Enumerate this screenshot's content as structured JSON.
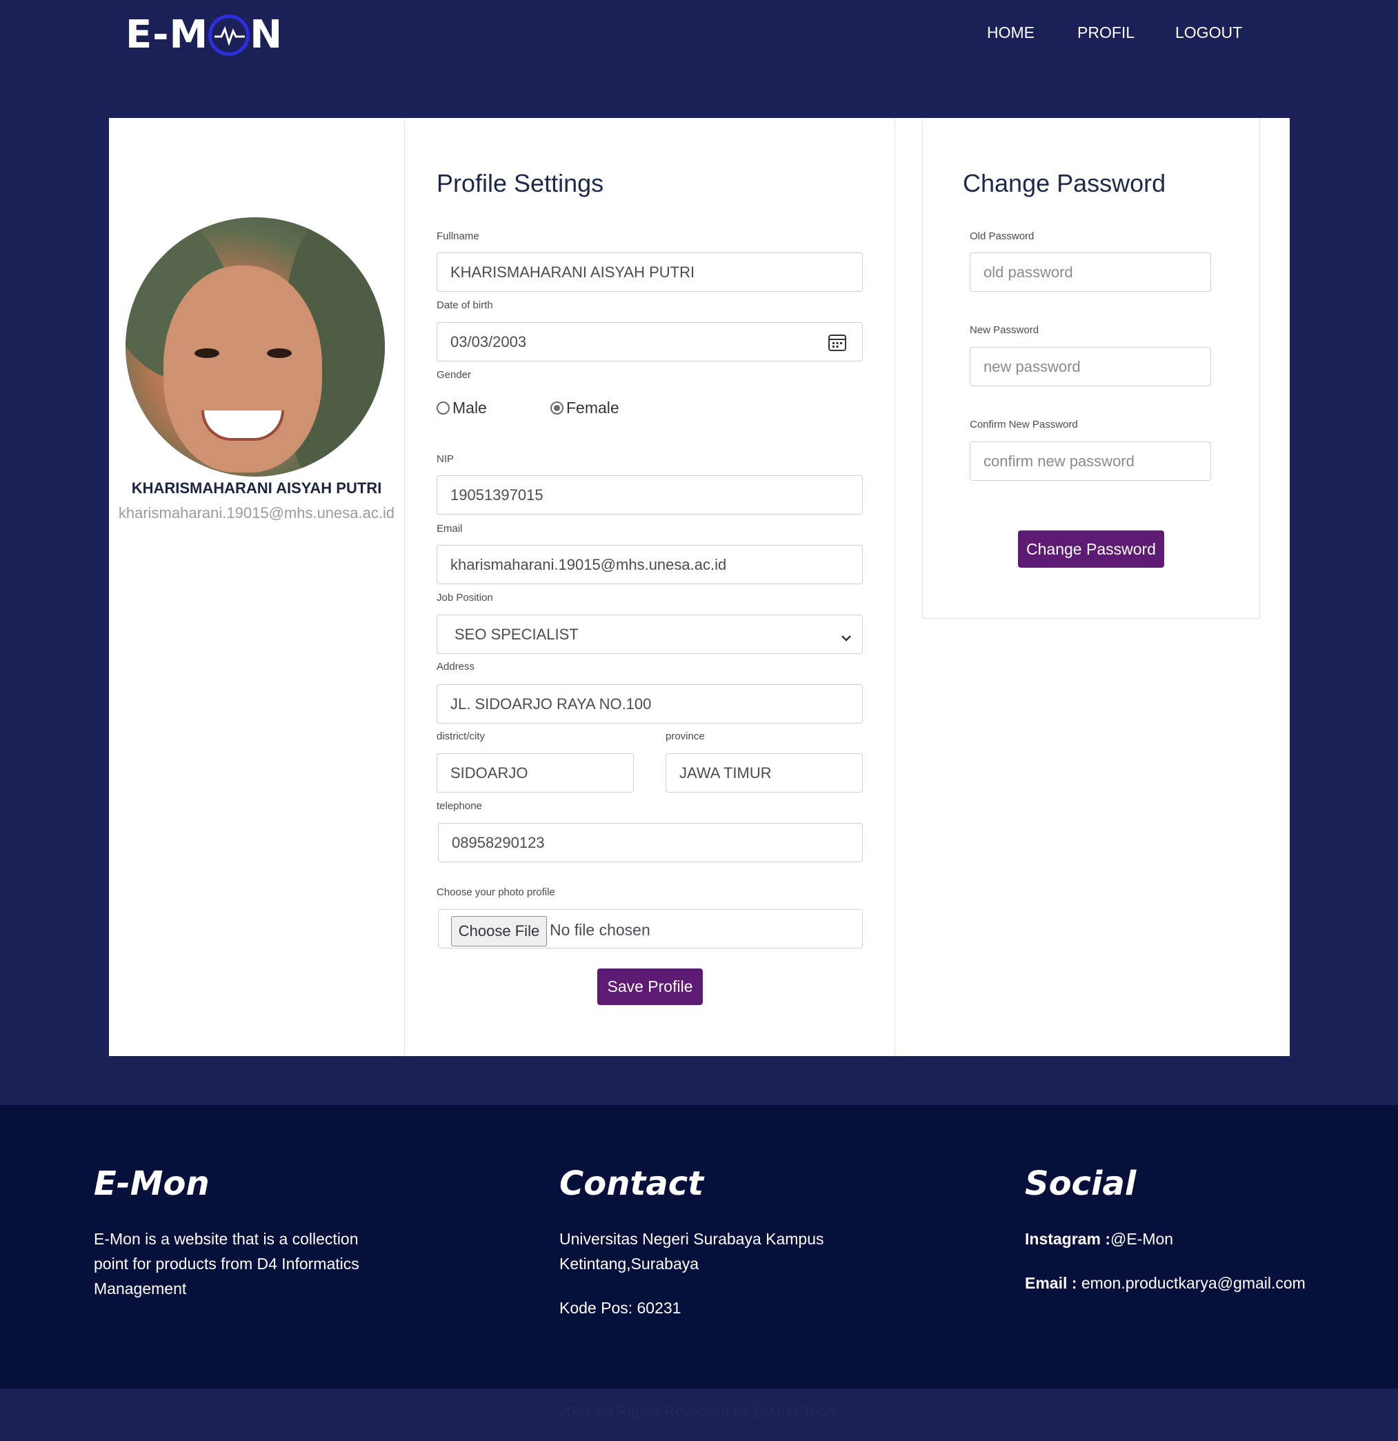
{
  "header": {
    "logo_text_left": "E-M",
    "logo_text_right": "N",
    "nav": [
      "HOME",
      "PROFIL",
      "LOGOUT"
    ]
  },
  "profile_card": {
    "name": "KHARISMAHARANI AISYAH PUTRI",
    "email": "kharismaharani.19015@mhs.unesa.ac.id"
  },
  "profile_settings": {
    "title": "Profile Settings",
    "fullname_label": "Fullname",
    "fullname_value": "KHARISMAHARANI AISYAH PUTRI",
    "dob_label": "Date of birth",
    "dob_value": "03/03/2003",
    "gender_label": "Gender",
    "gender_options": [
      "Male",
      "Female"
    ],
    "gender_selected": "Female",
    "nip_label": "NIP",
    "nip_value": "19051397015",
    "email_label": "Email",
    "email_value": "kharismaharani.19015@mhs.unesa.ac.id",
    "job_label": "Job Position",
    "job_value": "SEO SPECIALIST",
    "address_label": "Address",
    "address_value": "JL. SIDOARJO RAYA NO.100",
    "city_label": "district/city",
    "city_value": "SIDOARJO",
    "province_label": "province",
    "province_value": "JAWA TIMUR",
    "phone_label": "telephone",
    "phone_value": "08958290123",
    "photo_label": "Choose your photo profile",
    "choose_file": "Choose File",
    "no_file": "No file chosen",
    "save_button": "Save Profile"
  },
  "change_password": {
    "title": "Change Password",
    "old_label": "Old Password",
    "old_placeholder": "old password",
    "new_label": "New Password",
    "new_placeholder": "new password",
    "confirm_label": "Confirm New Password",
    "confirm_placeholder": "confirm new password",
    "button": "Change Password"
  },
  "footer": {
    "col1_title": "E-Mon",
    "col1_text": "E-Mon is a website that is a collection point for products from D4 Informatics Management",
    "col2_title": "Contact",
    "col2_address": "Universitas Negeri Surabaya Kampus Ketintang,Surabaya",
    "col2_postcode": "Kode Pos: 60231",
    "col3_title": "Social",
    "instagram_label": "Instagram :",
    "instagram_value": "@E-Mon",
    "email_label": "Email :",
    "email_value": "emon.productkarya@gmail.com",
    "copyright": "2021 All Rights Reversed by E-Mon Team"
  },
  "colors": {
    "page_bg": "#1b2057",
    "footer_bg": "#07103a",
    "button": "#5d1b73",
    "logo_ring": "#2c2ee0"
  }
}
